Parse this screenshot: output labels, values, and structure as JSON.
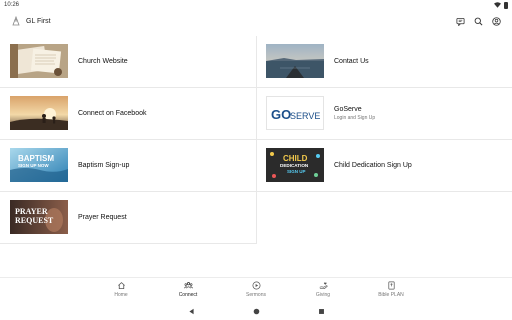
{
  "status_bar": {
    "time": "10:26"
  },
  "header": {
    "title": "GL First"
  },
  "tiles": [
    {
      "title": "Church Website",
      "subtitle": ""
    },
    {
      "title": "Contact Us",
      "subtitle": ""
    },
    {
      "title": "Connect on Facebook",
      "subtitle": ""
    },
    {
      "title": "GoServe",
      "subtitle": "Login and Sign Up",
      "logo_text_go": "GO",
      "logo_text_serve": "SERVE"
    },
    {
      "title": "Baptism Sign-up",
      "subtitle": "",
      "thumb_line1": "BAPTISM",
      "thumb_line2": "SIGN UP NOW"
    },
    {
      "title": "Child Dedication Sign Up",
      "subtitle": "",
      "thumb_line1": "CHILD",
      "thumb_line2": "DEDICATION",
      "thumb_line3": "SIGN UP"
    },
    {
      "title": "Prayer Request",
      "subtitle": "",
      "thumb_line1": "PRAYER",
      "thumb_line2": "REQUEST"
    }
  ],
  "bottom_nav": [
    {
      "label": "Home",
      "icon": "home-icon"
    },
    {
      "label": "Connect",
      "icon": "people-icon",
      "active": true
    },
    {
      "label": "Sermons",
      "icon": "play-icon"
    },
    {
      "label": "Giving",
      "icon": "hand-heart-icon"
    },
    {
      "label": "Bible PLAN",
      "icon": "bible-icon"
    }
  ],
  "colors": {
    "accent": "#1a73e8",
    "divider": "#e8e8e8"
  }
}
